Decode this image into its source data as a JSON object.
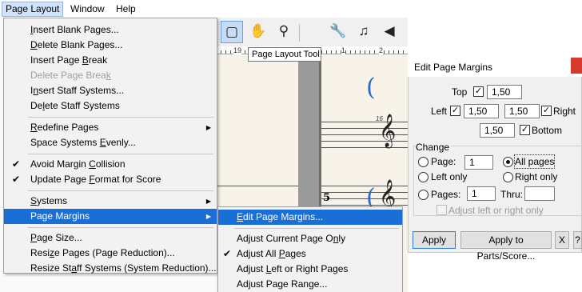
{
  "menubar": {
    "items": [
      "Page Layout",
      "Window",
      "Help"
    ]
  },
  "menu": {
    "items": [
      {
        "pre": "",
        "ul": "I",
        "post": "nsert Blank Pages...",
        "disabled": false
      },
      {
        "pre": "",
        "ul": "D",
        "post": "elete Blank Pages...",
        "disabled": false
      },
      {
        "pre": "Insert Page ",
        "ul": "B",
        "post": "reak",
        "disabled": false
      },
      {
        "pre": "Delete Page Brea",
        "ul": "k",
        "post": "",
        "disabled": true
      },
      {
        "pre": "I",
        "ul": "n",
        "post": "sert Staff Systems...",
        "disabled": false
      },
      {
        "pre": "De",
        "ul": "l",
        "post": "ete Staff Systems",
        "disabled": false
      },
      {
        "pre": "",
        "ul": "R",
        "post": "edefine Pages",
        "disabled": false,
        "submenu": true
      },
      {
        "pre": "Space Systems ",
        "ul": "E",
        "post": "venly...",
        "disabled": false
      },
      {
        "pre": "Avoid Margin ",
        "ul": "C",
        "post": "ollision",
        "checked": true
      },
      {
        "pre": "Update Page ",
        "ul": "F",
        "post": "ormat for Score",
        "checked": true
      },
      {
        "pre": "",
        "ul": "S",
        "post": "ystems",
        "submenu": true
      },
      {
        "pre": "Page Margins",
        "ul": "",
        "post": "",
        "submenu": true,
        "highlighted": true
      },
      {
        "pre": "",
        "ul": "P",
        "post": "age Size..."
      },
      {
        "pre": "Resi",
        "ul": "z",
        "post": "e Pages (Page Reduction)..."
      },
      {
        "pre": "Resize St",
        "ul": "a",
        "post": "ff Systems (System Reduction)..."
      }
    ]
  },
  "submenu": {
    "items": [
      {
        "pre": "",
        "ul": "E",
        "post": "dit Page Margins...",
        "highlighted": true
      },
      {
        "pre": "Adjust Current Page O",
        "ul": "n",
        "post": "ly"
      },
      {
        "pre": "Adjust All ",
        "ul": "P",
        "post": "ages",
        "checked": true
      },
      {
        "pre": "Adjust ",
        "ul": "L",
        "post": "eft or Right Pages"
      },
      {
        "pre": "Ad",
        "ul": "j",
        "post": "ust Page Range..."
      }
    ]
  },
  "toolbar": {
    "tooltip": "Page Layout Tool"
  },
  "ruler": {
    "labels": [
      "19",
      "1",
      "2"
    ]
  },
  "score": {
    "measure_number": "5",
    "small_number": "16"
  },
  "dialog": {
    "title": "Edit Page Margins",
    "top_label": "Top",
    "top_value": "1,50",
    "left_label": "Left",
    "left_value": "1,50",
    "right_value": "1,50",
    "right_label": "Right",
    "bottom_value": "1,50",
    "bottom_label": "Bottom",
    "change_label": "Change",
    "page_label": "Page:",
    "page_value": "1",
    "all_pages_label": "All pages",
    "left_only_label": "Left only",
    "right_only_label": "Right only",
    "pages_label": "Pages:",
    "pages_value": "1",
    "thru_label": "Thru:",
    "thru_value": "",
    "adjust_lr_label": "Adjust left or right only",
    "apply_label": "Apply",
    "apply_parts_label": "Apply to Parts/Score...",
    "x_label": "X",
    "help_label": "?"
  }
}
